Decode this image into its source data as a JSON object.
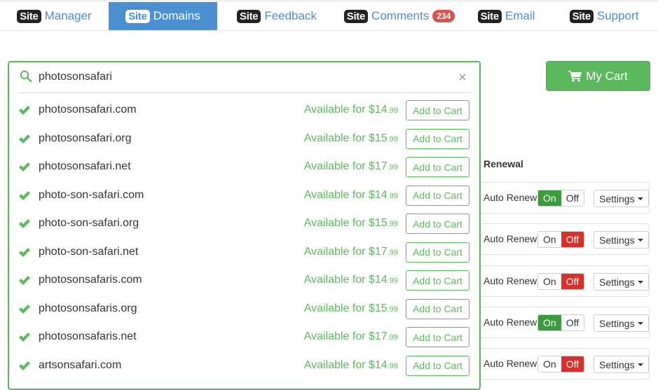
{
  "nav": {
    "badge_text": "Site",
    "tabs": [
      {
        "label": "Manager",
        "active": false
      },
      {
        "label": "Domains",
        "active": true
      },
      {
        "label": "Feedback",
        "active": false
      },
      {
        "label": "Comments",
        "active": false,
        "count": "234"
      },
      {
        "label": "Email",
        "active": false
      },
      {
        "label": "Support",
        "active": false
      }
    ]
  },
  "cart": {
    "label": "My Cart",
    "icon": "shopping-cart-icon"
  },
  "search": {
    "value": "photosonsafari",
    "icon": "search-icon",
    "clear_icon": "close-icon",
    "available_prefix": "Available for $",
    "add_label": "Add to Cart",
    "results": [
      {
        "domain": "photosonsafari.com",
        "dollars": "14",
        "cents": ".99"
      },
      {
        "domain": "photosonsafari.org",
        "dollars": "15",
        "cents": ".99"
      },
      {
        "domain": "photosonsafari.net",
        "dollars": "17",
        "cents": ".99"
      },
      {
        "domain": "photo-son-safari.com",
        "dollars": "14",
        "cents": ".99"
      },
      {
        "domain": "photo-son-safari.org",
        "dollars": "15",
        "cents": ".99"
      },
      {
        "domain": "photo-son-safari.net",
        "dollars": "17",
        "cents": ".99"
      },
      {
        "domain": "photosonsafaris.com",
        "dollars": "14",
        "cents": ".99"
      },
      {
        "domain": "photosonsafaris.org",
        "dollars": "15",
        "cents": ".99"
      },
      {
        "domain": "photosonsafaris.net",
        "dollars": "17",
        "cents": ".99"
      },
      {
        "domain": "artsonsafari.com",
        "dollars": "14",
        "cents": ".99"
      }
    ]
  },
  "renewal": {
    "header": "Renewal",
    "label": "Auto Renew",
    "on_label": "On",
    "off_label": "Off",
    "settings_label": "Settings",
    "rows": [
      {
        "state": "on"
      },
      {
        "state": "off"
      },
      {
        "state": "off"
      },
      {
        "state": "on"
      },
      {
        "state": "off"
      }
    ]
  },
  "colors": {
    "brand_blue": "#4a8fd0",
    "success_green": "#5cb85c",
    "toggle_on": "#3c9b3c",
    "toggle_off": "#d9302c",
    "badge_red": "#d9534f"
  }
}
